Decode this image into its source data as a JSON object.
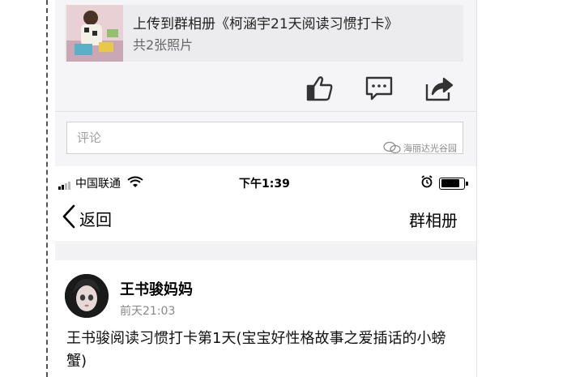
{
  "upload": {
    "title": "上传到群相册《柯涵宇21天阅读习惯打卡》",
    "subtitle": "共2张照片"
  },
  "actions": {
    "like_icon": "thumbs-up-icon",
    "comment_icon": "comment-bubble-icon",
    "share_icon": "share-icon"
  },
  "comment": {
    "placeholder": "评论"
  },
  "watermark": {
    "text": "海丽达光谷园"
  },
  "status_bar": {
    "carrier": "中国联通",
    "time": "下午1:39",
    "battery_level": 0.85
  },
  "nav": {
    "back_label": "返回",
    "title": "群相册"
  },
  "post": {
    "author": "王书骏妈妈",
    "time": "前天21:03",
    "text": "王书骏阅读习惯打卡第1天(宝宝好性格故事之爱插话的小螃蟹)"
  },
  "colors": {
    "background_panel": "#f5f5f7",
    "icon": "#333333",
    "secondary_text": "#888888"
  }
}
